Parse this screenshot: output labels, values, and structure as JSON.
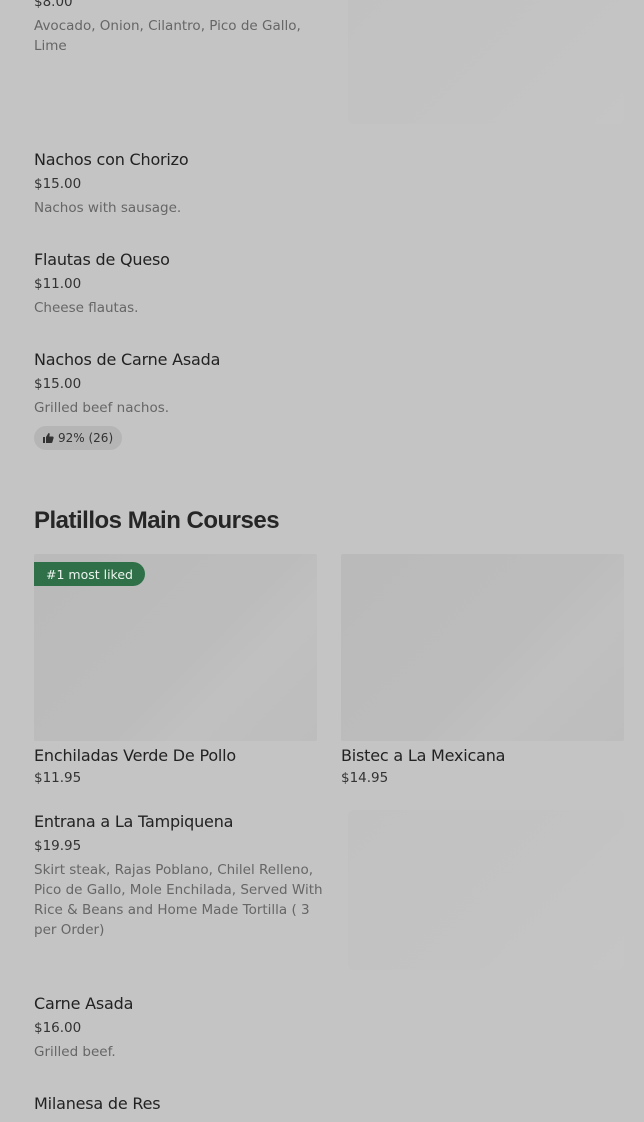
{
  "items_top": [
    {
      "price": "$8.00",
      "desc": "Avocado, Onion, Cilantro, Pico de Gallo, Lime"
    },
    {
      "name": "Nachos con Chorizo",
      "price": "$15.00",
      "desc": "Nachos with sausage."
    },
    {
      "name": "Flautas de Queso",
      "price": "$11.00",
      "desc": "Cheese flautas."
    },
    {
      "name": "Nachos de Carne Asada",
      "price": "$15.00",
      "desc": "Grilled beef nachos.",
      "rating": "92% (26)"
    }
  ],
  "section": {
    "title": "Platillos Main Courses"
  },
  "featured": [
    {
      "name": "Enchiladas Verde De Pollo",
      "price": "$11.95",
      "badge": "#1 most liked"
    },
    {
      "name": "Bistec a La Mexicana",
      "price": "$14.95"
    }
  ],
  "items_bottom": [
    {
      "name": "Entrana a La Tampiquena",
      "price": "$19.95",
      "desc": "Skirt steak, Rajas Poblano, Chilel Relleno, Pico de Gallo, Mole Enchilada, Served With Rice & Beans and Home Made Tortilla ( 3 per Order)"
    },
    {
      "name": "Carne Asada",
      "price": "$16.00",
      "desc": "Grilled beef."
    },
    {
      "name": "Milanesa de Res"
    }
  ],
  "colors": {
    "background": "#c4c4c4",
    "badge_green": "#2f7049"
  },
  "icons": {
    "rating": "thumbs-up-icon"
  }
}
